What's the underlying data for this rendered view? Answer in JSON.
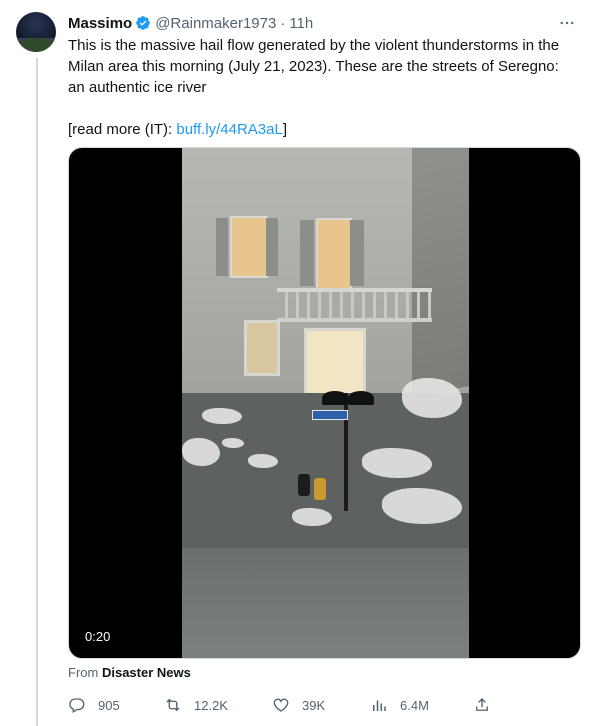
{
  "tweet": {
    "author": {
      "name": "Massimo",
      "handle": "@Rainmaker1973",
      "separator": "·",
      "time": "11h",
      "verified_icon": "verified-badge-icon",
      "avatar_icon": "avatar"
    },
    "text": {
      "line1": "This is the massive hail flow generated by the violent thunderstorms in the Milan area this morning (July 21, 2023). These are the streets of Seregno: an authentic ice river",
      "readmore_prefix": "[read more (IT): ",
      "readmore_link": "buff.ly/44RA3aL",
      "readmore_suffix": "]"
    },
    "media": {
      "video_time": "0:20"
    },
    "source": {
      "prefix": "From",
      "name": "Disaster News"
    },
    "actions": {
      "replies": "905",
      "retweets": "12.2K",
      "likes": "39K",
      "views": "6.4M"
    },
    "colors": {
      "link": "#1d9bf0",
      "secondary": "#536471",
      "primary": "#0f1419",
      "verified": "#1d9bf0"
    }
  }
}
